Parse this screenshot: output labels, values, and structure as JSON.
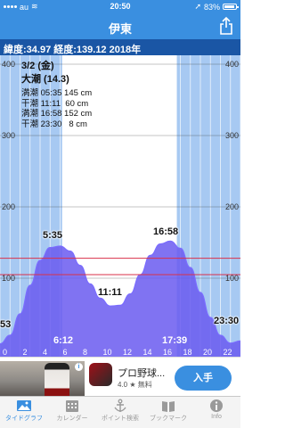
{
  "status": {
    "carrier": "au",
    "time": "20:50",
    "battery": "83%"
  },
  "nav": {
    "title": "伊東"
  },
  "location": {
    "text": "緯度:34.97 経度:139.12  2018年"
  },
  "tide_info": {
    "date": "3/2 (金)",
    "moon": "大潮 (14.3)",
    "rows": [
      "満潮 05:35 145 cm",
      "干潮 11:11  60 cm",
      "満潮 16:58 152 cm",
      "干潮 23:30   8 cm"
    ]
  },
  "peak_labels": {
    "high1": "5:35",
    "low1": "11:11",
    "high2": "16:58",
    "low0": "53",
    "low2": "23:30"
  },
  "sun_labels": {
    "sunrise": "6:12",
    "sunset": "17:39"
  },
  "chart_data": {
    "type": "area",
    "x": [
      0,
      1,
      2,
      3,
      4,
      5,
      6,
      7,
      8,
      9,
      10,
      11,
      12,
      13,
      14,
      15,
      16,
      17,
      18,
      19,
      20,
      21,
      22,
      23,
      24
    ],
    "y": [
      8,
      20,
      50,
      90,
      125,
      143,
      145,
      138,
      118,
      92,
      72,
      61,
      62,
      78,
      105,
      132,
      148,
      152,
      142,
      115,
      80,
      45,
      20,
      9,
      12
    ],
    "xlim": [
      0,
      24
    ],
    "ylim": [
      0,
      450
    ],
    "y_ticks": [
      100,
      200,
      300,
      400
    ],
    "x_ticks": [
      0,
      2,
      4,
      6,
      8,
      10,
      12,
      14,
      16,
      18,
      20,
      22
    ],
    "reference_lines": [
      {
        "y": 128,
        "color": "#d9304a"
      },
      {
        "y": 105,
        "color": "#d9304a"
      }
    ],
    "daylight": [
      6.2,
      17.65
    ],
    "colors": {
      "night": "#a7c9f2",
      "day": "#ffffff",
      "fill": "#6a5af0",
      "curve": "#7a6cff"
    }
  },
  "ad": {
    "title": "プロ野球...",
    "rating": "4.0 ★ 無料",
    "install": "入手",
    "info": "i"
  },
  "tabs": [
    {
      "label": "タイドグラフ",
      "icon": "image-icon",
      "active": true
    },
    {
      "label": "カレンダー",
      "icon": "calendar-icon",
      "active": false
    },
    {
      "label": "ポイント検索",
      "icon": "anchor-icon",
      "active": false
    },
    {
      "label": "ブックマーク",
      "icon": "bookmark-icon",
      "active": false
    },
    {
      "label": "Info",
      "icon": "info-icon",
      "active": false
    }
  ]
}
